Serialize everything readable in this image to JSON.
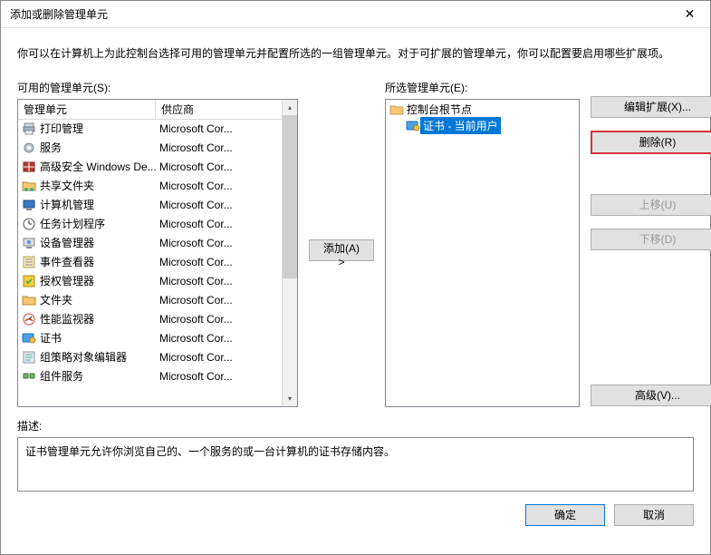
{
  "window": {
    "title": "添加或删除管理单元",
    "close_glyph": "✕"
  },
  "intro": "你可以在计算机上为此控制台选择可用的管理单元并配置所选的一组管理单元。对于可扩展的管理单元，你可以配置要启用哪些扩展项。",
  "available": {
    "label": "可用的管理单元(S):",
    "columns": {
      "name": "管理单元",
      "vendor": "供应商"
    },
    "items": [
      {
        "icon": "printer-icon",
        "name": "打印管理",
        "vendor": "Microsoft Cor..."
      },
      {
        "icon": "gear-icon",
        "name": "服务",
        "vendor": "Microsoft Cor..."
      },
      {
        "icon": "firewall-icon",
        "name": "高级安全 Windows De...",
        "vendor": "Microsoft Cor..."
      },
      {
        "icon": "shared-folder-icon",
        "name": "共享文件夹",
        "vendor": "Microsoft Cor..."
      },
      {
        "icon": "computer-mgmt-icon",
        "name": "计算机管理",
        "vendor": "Microsoft Cor..."
      },
      {
        "icon": "scheduler-icon",
        "name": "任务计划程序",
        "vendor": "Microsoft Cor..."
      },
      {
        "icon": "device-mgr-icon",
        "name": "设备管理器",
        "vendor": "Microsoft Cor..."
      },
      {
        "icon": "event-viewer-icon",
        "name": "事件查看器",
        "vendor": "Microsoft Cor..."
      },
      {
        "icon": "auth-mgr-icon",
        "name": "授权管理器",
        "vendor": "Microsoft Cor..."
      },
      {
        "icon": "folder-icon",
        "name": "文件夹",
        "vendor": "Microsoft Cor..."
      },
      {
        "icon": "perf-monitor-icon",
        "name": "性能监视器",
        "vendor": "Microsoft Cor..."
      },
      {
        "icon": "certificate-icon",
        "name": "证书",
        "vendor": "Microsoft Cor..."
      },
      {
        "icon": "gpo-editor-icon",
        "name": "组策略对象编辑器",
        "vendor": "Microsoft Cor..."
      },
      {
        "icon": "component-svc-icon",
        "name": "组件服务",
        "vendor": "Microsoft Cor..."
      }
    ]
  },
  "add_button": "添加(A) >",
  "selected": {
    "label": "所选管理单元(E):",
    "root": {
      "icon": "folder-icon",
      "label": "控制台根节点"
    },
    "child": {
      "icon": "certificate-blue-icon",
      "label": "证书 - 当前用户"
    }
  },
  "buttons": {
    "edit_ext": "编辑扩展(X)...",
    "delete": "删除(R)",
    "move_up": "上移(U)",
    "move_down": "下移(D)",
    "advanced": "高级(V)..."
  },
  "description": {
    "label": "描述:",
    "text": "证书管理单元允许你浏览自己的、一个服务的或一台计算机的证书存储内容。"
  },
  "footer": {
    "ok": "确定",
    "cancel": "取消"
  }
}
